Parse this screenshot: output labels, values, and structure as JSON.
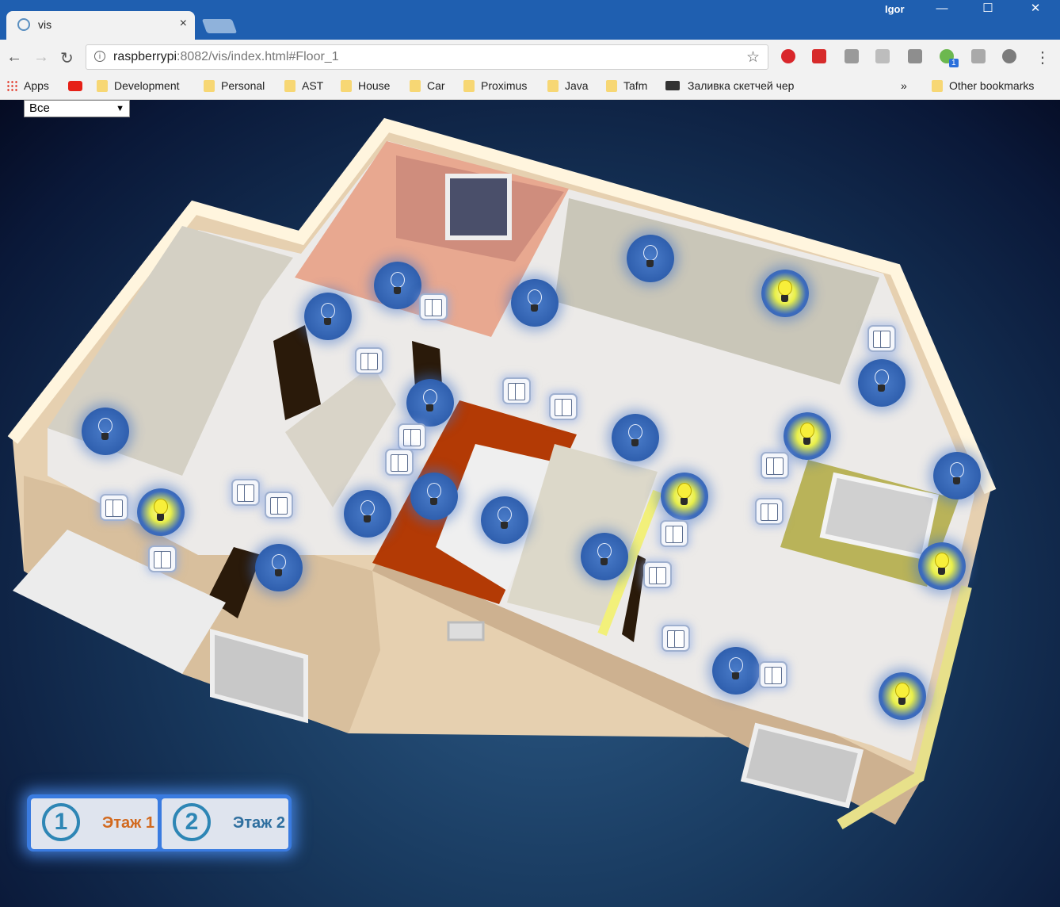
{
  "browser": {
    "tab_title": "vis",
    "tab_close": "×",
    "user": "Igor",
    "win_min": "—",
    "win_max": "☐",
    "win_close": "✕",
    "back": "←",
    "forward": "→",
    "reload": "↻",
    "url_host": "raspberrypi",
    "url_rest": ":8082/vis/index.html#Floor_1",
    "info": "i",
    "star": "☆",
    "menu": "⋮",
    "ext_badge": "1",
    "bookmarks": {
      "apps": "Apps",
      "items": [
        "Development",
        "Personal",
        "AST",
        "House",
        "Car",
        "Proximus",
        "Java",
        "Tafm"
      ],
      "sketch": "Заливка скетчей чер",
      "overflow": "»",
      "other": "Other bookmarks"
    }
  },
  "app": {
    "view_select": "Все",
    "select_arrow": "▼",
    "floors": [
      {
        "number": "1",
        "label": "Этаж 1",
        "color": "#d2691e"
      },
      {
        "number": "2",
        "label": "Этаж 2",
        "color": "#2f6f9f"
      }
    ],
    "lamps": [
      {
        "state": "off"
      },
      {
        "state": "off"
      },
      {
        "state": "off"
      },
      {
        "state": "on"
      },
      {
        "state": "off"
      },
      {
        "state": "off"
      },
      {
        "state": "off"
      },
      {
        "state": "off"
      },
      {
        "state": "on"
      },
      {
        "state": "off"
      },
      {
        "state": "on"
      },
      {
        "state": "off"
      },
      {
        "state": "off"
      },
      {
        "state": "off"
      },
      {
        "state": "off"
      },
      {
        "state": "on"
      },
      {
        "state": "off"
      },
      {
        "state": "off"
      },
      {
        "state": "on"
      },
      {
        "state": "off"
      },
      {
        "state": "on"
      }
    ],
    "switch_count": 21
  }
}
